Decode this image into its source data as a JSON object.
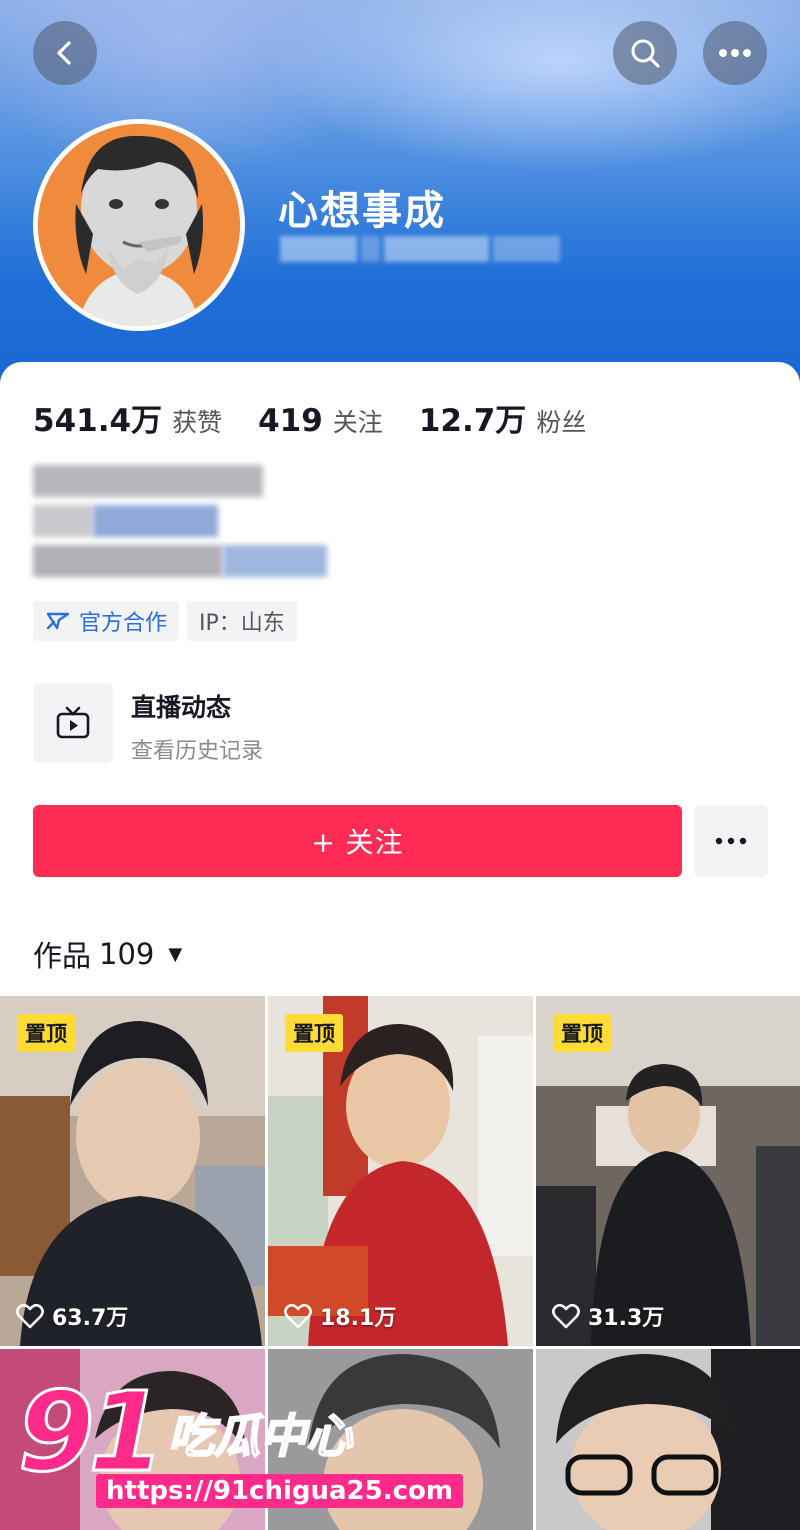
{
  "profile": {
    "nickname": "心想事成",
    "avatar_icon": "portrait-avatar"
  },
  "header": {
    "back_icon": "chevron-left-icon",
    "search_icon": "search-icon",
    "more_icon": "more-dots-icon"
  },
  "stats": [
    {
      "value": "541.4万",
      "label": "获赞"
    },
    {
      "value": "419",
      "label": "关注"
    },
    {
      "value": "12.7万",
      "label": "粉丝"
    }
  ],
  "tags": {
    "official": "官方合作",
    "ip": "IP：山东"
  },
  "live": {
    "title": "直播动态",
    "subtitle": "查看历史记录"
  },
  "actions": {
    "follow_label": "+ 关注"
  },
  "works": {
    "label": "作品",
    "count": "109"
  },
  "videos": [
    {
      "pinned": "置顶",
      "likes": "63.7万"
    },
    {
      "pinned": "置顶",
      "likes": "18.1万"
    },
    {
      "pinned": "置顶",
      "likes": "31.3万"
    },
    {
      "pinned": "",
      "likes": ""
    },
    {
      "pinned": "",
      "likes": ""
    },
    {
      "pinned": "",
      "likes": ""
    }
  ],
  "watermark": {
    "number": "91",
    "name": "吃瓜中心",
    "url": "https://91chigua25.com"
  },
  "colors": {
    "accent": "#fe2c55",
    "header_blue": "#1f6fd8",
    "pin_yellow": "#fedb35",
    "official_blue": "#2a6fdb"
  }
}
